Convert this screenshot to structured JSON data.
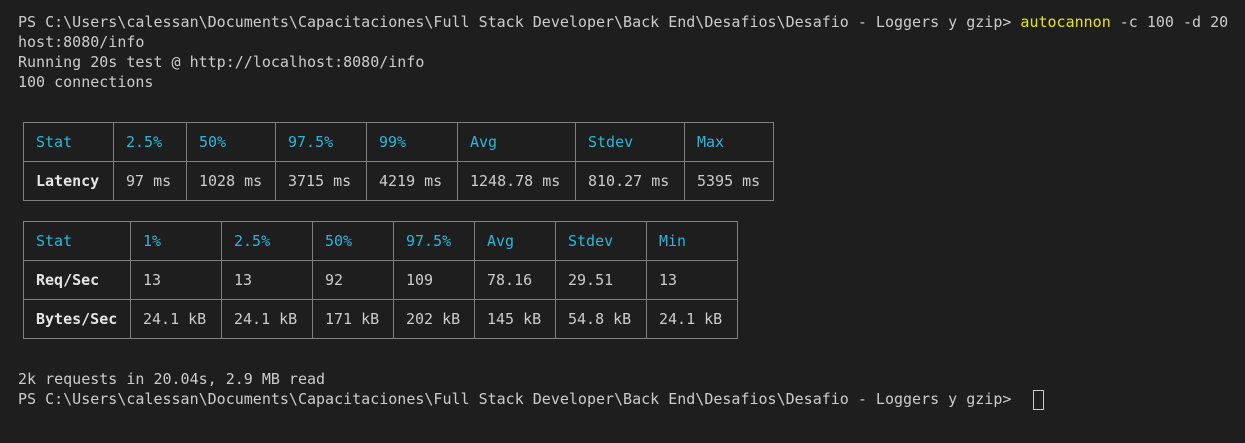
{
  "terminal": {
    "prompt": "PS C:\\Users\\calessan\\Documents\\Capacitaciones\\Full Stack Developer\\Back End\\Desafios\\Desafio - Loggers y gzip>",
    "command": {
      "program": "autocannon",
      "flag_c": "-c",
      "val_c": "100",
      "flag_d": "-d",
      "val_d": "20",
      "url_wrapped": "host:8080/info"
    },
    "running_line": "Running 20s test @ http://localhost:8080/info",
    "connections_line": "100 connections",
    "summary_line": "2k requests in 20.04s, 2.9 MB read"
  },
  "latency_table": {
    "headers": [
      "Stat",
      "2.5%",
      "50%",
      "97.5%",
      "99%",
      "Avg",
      "Stdev",
      "Max"
    ],
    "row": [
      "Latency",
      "97 ms",
      "1028 ms",
      "3715 ms",
      "4219 ms",
      "1248.78 ms",
      "810.27 ms",
      "5395 ms"
    ]
  },
  "throughput_table": {
    "headers": [
      "Stat",
      "1%",
      "2.5%",
      "50%",
      "97.5%",
      "Avg",
      "Stdev",
      "Min"
    ],
    "rows": [
      [
        "Req/Sec",
        "13",
        "13",
        "92",
        "109",
        "78.16",
        "29.51",
        "13"
      ],
      [
        "Bytes/Sec",
        "24.1 kB",
        "24.1 kB",
        "171 kB",
        "202 kB",
        "145 kB",
        "54.8 kB",
        "24.1 kB"
      ]
    ]
  },
  "colors": {
    "background": "#1e1e1e",
    "text": "#cccccc",
    "command": "#e5e510",
    "header": "#29b8db",
    "border": "#808080"
  }
}
